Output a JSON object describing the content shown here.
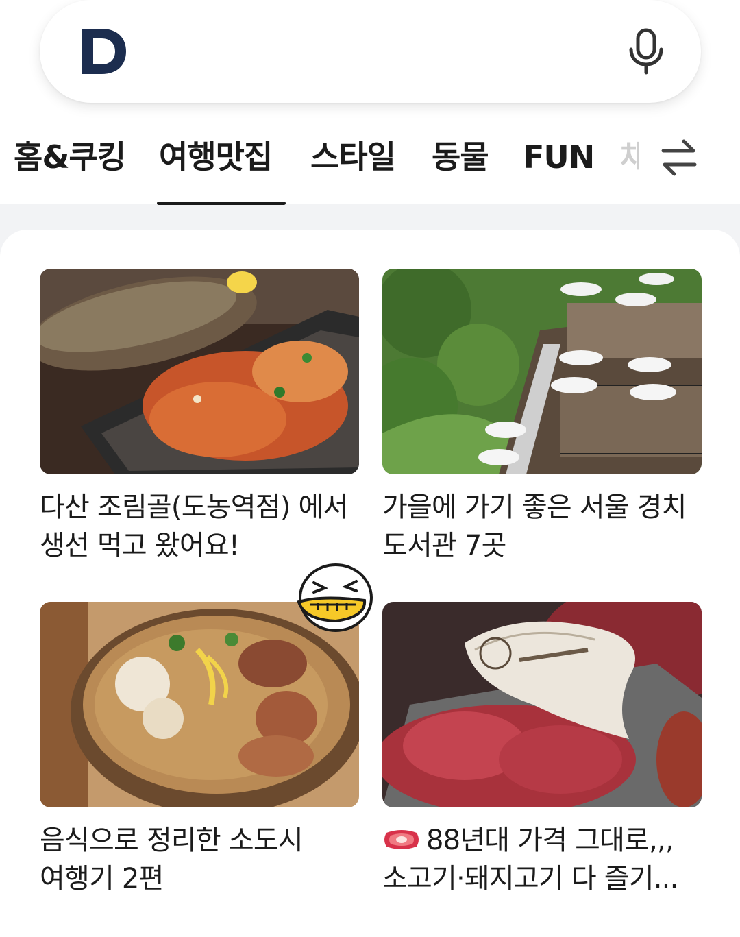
{
  "search": {
    "logo_icon": "daum-d-logo-icon",
    "mic_icon": "microphone-icon"
  },
  "tabs": {
    "items": [
      "홈&쿠킹",
      "여행맛집",
      "스타일",
      "동물",
      "FUN",
      "채"
    ],
    "active_index": 1,
    "swap_icon": "swap-arrows-icon"
  },
  "cards": [
    {
      "title": "다산 조림골(도농역점) 에서 생선 먹고 왔어요!",
      "image": "grilled-fish-and-spicy-pork-photo"
    },
    {
      "title": "가을에 가기 좋은 서울 경치 도서관 7곳",
      "image": "terrace-library-in-forest-photo"
    },
    {
      "title": "음식으로 정리한 소도시 여행기 2편",
      "image": "ramen-bowl-photo"
    },
    {
      "title": "88년대 가격 그대로,,, 소고기·돼지고기 다 즐기...",
      "image": "raw-beef-platter-photo",
      "emoji": "meat-emoji-icon"
    }
  ],
  "colors": {
    "text": "#1b1b1b",
    "logo": "#1c2d4f",
    "background": "#f2f3f5"
  }
}
